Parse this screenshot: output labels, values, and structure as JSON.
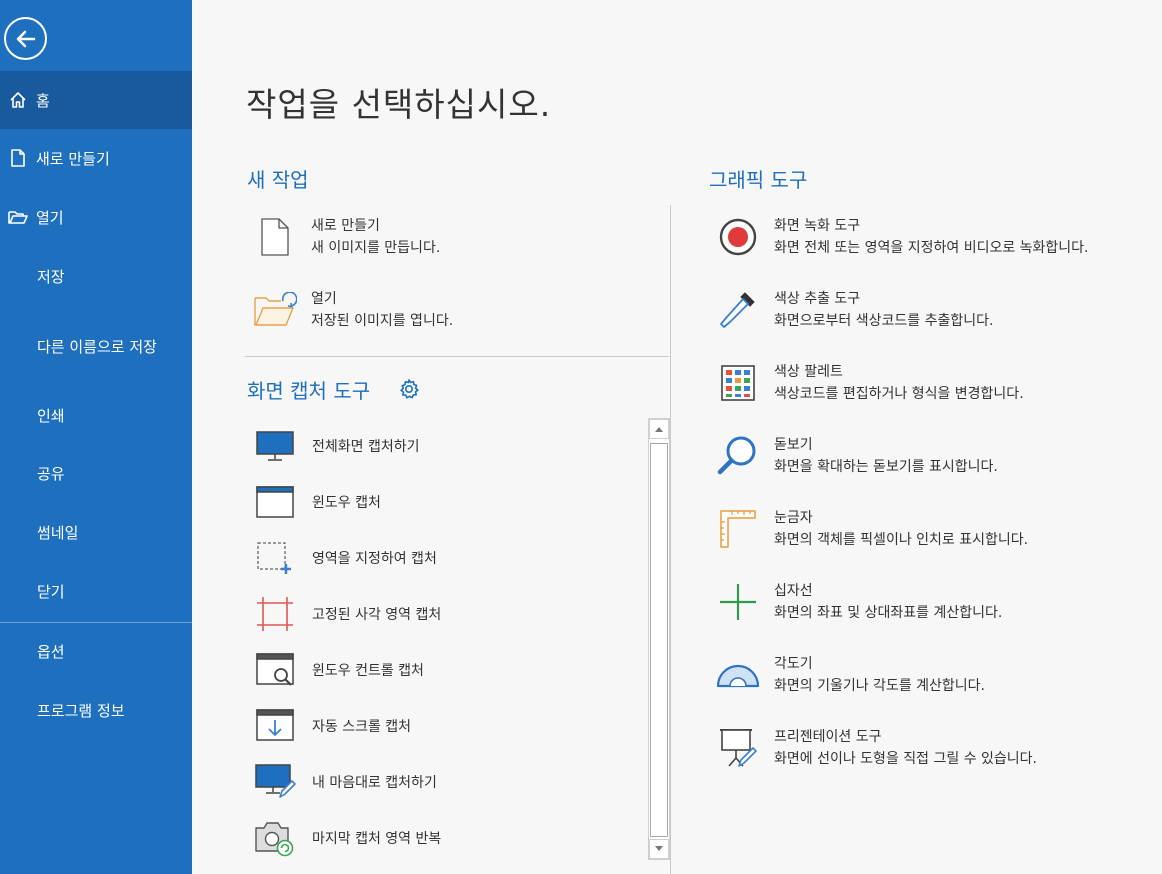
{
  "sidebar": {
    "back_icon": "back-arrow-icon",
    "items": [
      {
        "label": "홈",
        "icon": "home-icon",
        "active": true
      },
      {
        "label": "새로 만들기",
        "icon": "new-file-icon"
      },
      {
        "label": "열기",
        "icon": "folder-open-icon"
      },
      {
        "label": "저장"
      },
      {
        "label": "다른 이름으로 저장"
      },
      {
        "label": "인쇄"
      },
      {
        "label": "공유"
      },
      {
        "label": "썸네일"
      },
      {
        "label": "닫기"
      },
      {
        "label": "옵션"
      },
      {
        "label": "프로그램 정보"
      }
    ]
  },
  "main": {
    "title": "작업을 선택하십시오.",
    "new_task": {
      "heading": "새 작업",
      "items": [
        {
          "title": "새로 만들기",
          "desc": "새 이미지를 만듭니다.",
          "icon": "new-document-icon"
        },
        {
          "title": "열기",
          "desc": "저장된 이미지를 엽니다.",
          "icon": "open-folder-icon"
        }
      ]
    },
    "capture": {
      "heading": "화면 캡처 도구",
      "settings_icon": "gear-icon",
      "items": [
        {
          "label": "전체화면 캡처하기",
          "icon": "monitor-icon"
        },
        {
          "label": "윈도우 캡처",
          "icon": "window-icon"
        },
        {
          "label": "영역을 지정하여 캡처",
          "icon": "region-select-icon"
        },
        {
          "label": "고정된 사각 영역 캡처",
          "icon": "fixed-rect-icon"
        },
        {
          "label": "윈도우 컨트롤 캡처",
          "icon": "window-control-icon"
        },
        {
          "label": "자동 스크롤 캡처",
          "icon": "auto-scroll-icon"
        },
        {
          "label": "내 마음대로 캡처하기",
          "icon": "freehand-capture-icon"
        },
        {
          "label": "마지막 캡처 영역 반복",
          "icon": "repeat-capture-icon"
        }
      ]
    },
    "graphic": {
      "heading": "그래픽 도구",
      "items": [
        {
          "title": "화면 녹화 도구",
          "desc": "화면 전체 또는 영역을 지정하여 비디오로 녹화합니다.",
          "icon": "record-icon"
        },
        {
          "title": "색상 추출 도구",
          "desc": "화면으로부터 색상코드를 추출합니다.",
          "icon": "eyedropper-icon"
        },
        {
          "title": "색상 팔레트",
          "desc": "색상코드를 편집하거나 형식을 변경합니다.",
          "icon": "palette-icon"
        },
        {
          "title": "돋보기",
          "desc": "화면을 확대하는 돋보기를 표시합니다.",
          "icon": "magnifier-icon"
        },
        {
          "title": "눈금자",
          "desc": "화면의 객체를 픽셀이나 인치로 표시합니다.",
          "icon": "ruler-icon"
        },
        {
          "title": "십자선",
          "desc": "화면의 좌표 및 상대좌표를 계산합니다.",
          "icon": "crosshair-icon"
        },
        {
          "title": "각도기",
          "desc": "화면의 기울기나 각도를 계산합니다.",
          "icon": "protractor-icon"
        },
        {
          "title": "프리젠테이션 도구",
          "desc": "화면에 선이나 도형을 직접 그릴 수 있습니다.",
          "icon": "presentation-icon"
        }
      ]
    }
  },
  "colors": {
    "sidebar_bg": "#1e6fbd",
    "sidebar_active": "#185a9d",
    "heading_blue": "#1f6fbe",
    "record_red": "#e03a3a"
  }
}
